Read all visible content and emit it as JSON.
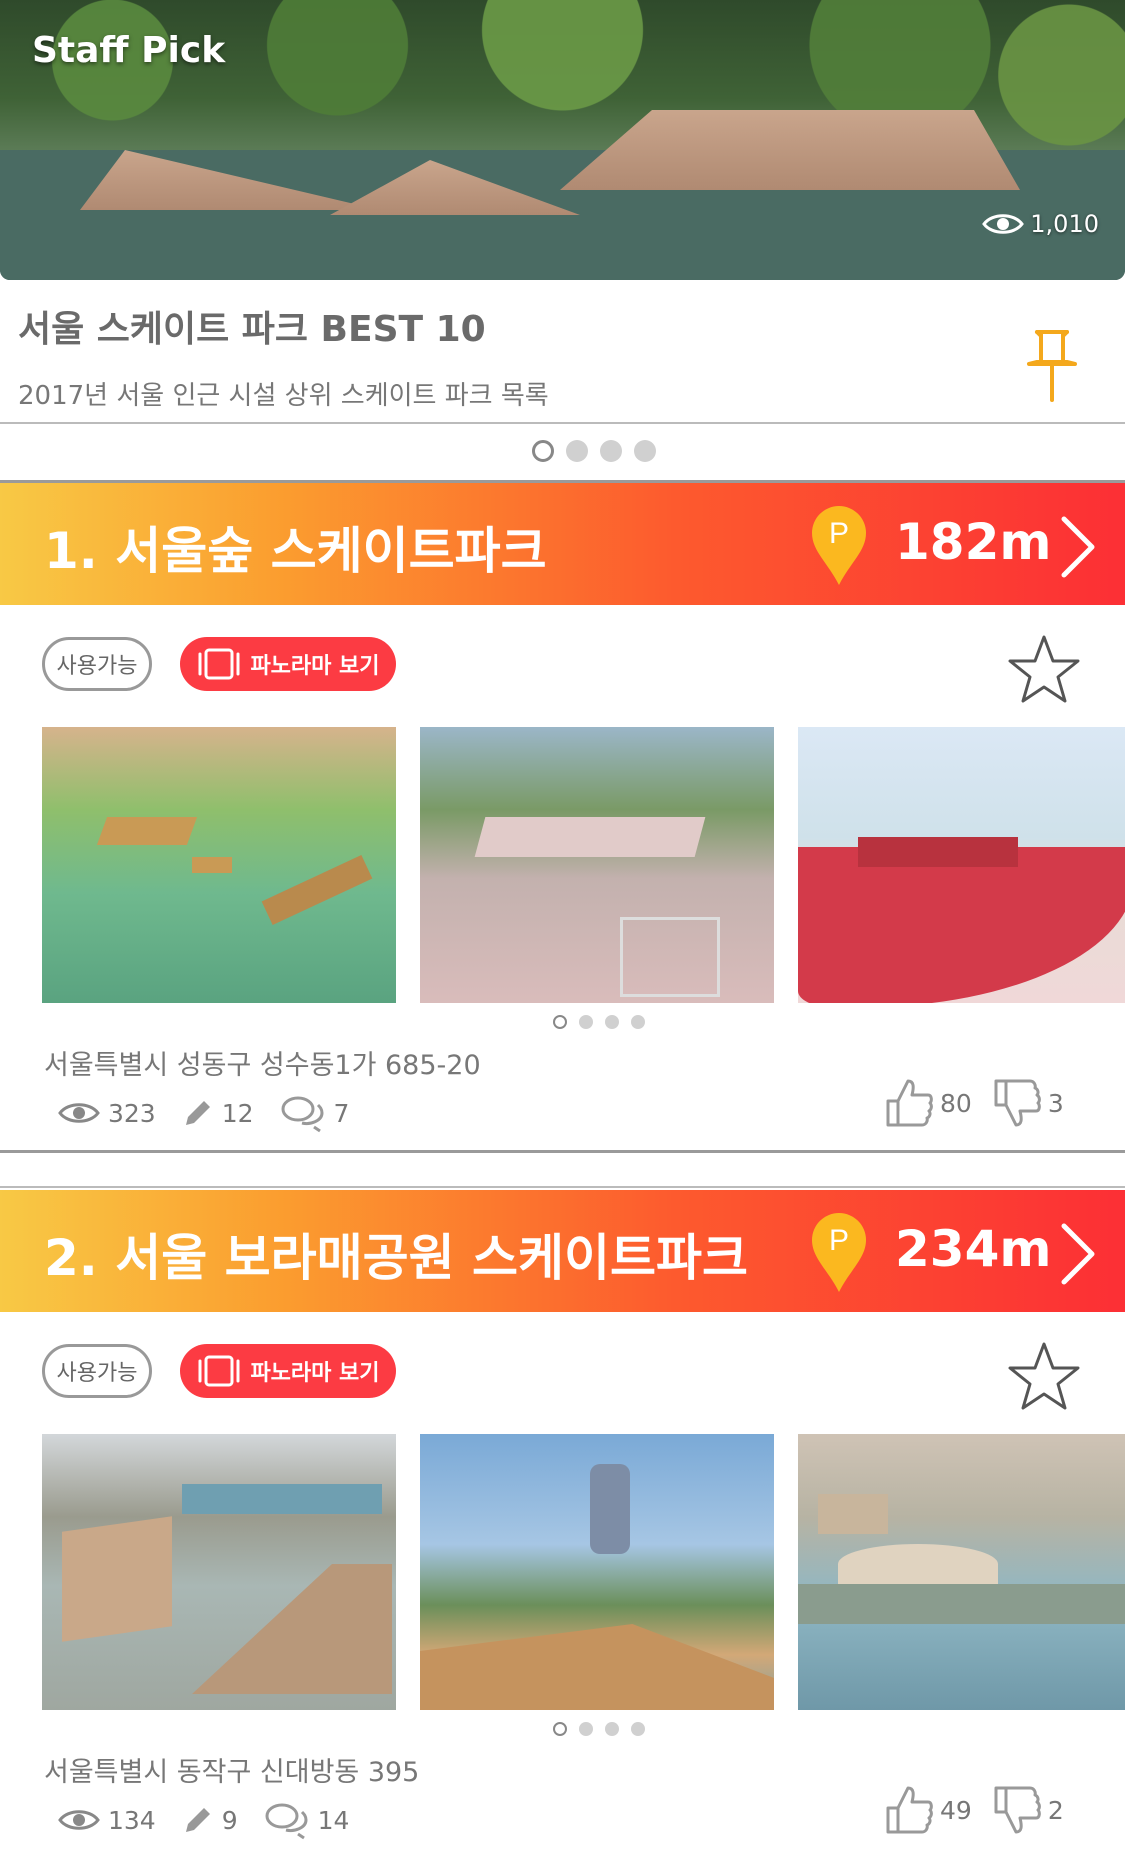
{
  "staff_pick": {
    "label": "Staff Pick",
    "views": "1,010",
    "title": "서울 스케이트 파크 BEST 10",
    "subtitle": "2017년 서울 인근 시설 상위 스케이트 파크 목록",
    "pin_icon": "pushpin-icon",
    "carousel": {
      "count": 4,
      "active": 0
    }
  },
  "parks": [
    {
      "title": "1. 서울숲 스케이트파크",
      "marker_letter": "P",
      "distance": "182m",
      "status": "사용가능",
      "panorama_label": "파노라마 보기",
      "address": "서울특별시 성동구 성수동1가 685-20",
      "views": "323",
      "edits": "12",
      "comments": "7",
      "likes": "80",
      "dislikes": "3",
      "photo_carousel": {
        "count": 4,
        "active": 0
      }
    },
    {
      "title": "2. 서울 보라매공원 스케이트파크",
      "marker_letter": "P",
      "distance": "234m",
      "status": "사용가능",
      "panorama_label": "파노라마 보기",
      "address": "서울특별시 동작구 신대방동 395",
      "views": "134",
      "edits": "9",
      "comments": "14",
      "likes": "49",
      "dislikes": "2",
      "photo_carousel": {
        "count": 4,
        "active": 0
      }
    }
  ],
  "colors": {
    "banner_start": "#f8c945",
    "banner_end": "#fc2f35",
    "panorama_button": "#fc3b43",
    "marker": "#fbb81f",
    "pin": "#f4a81c"
  }
}
